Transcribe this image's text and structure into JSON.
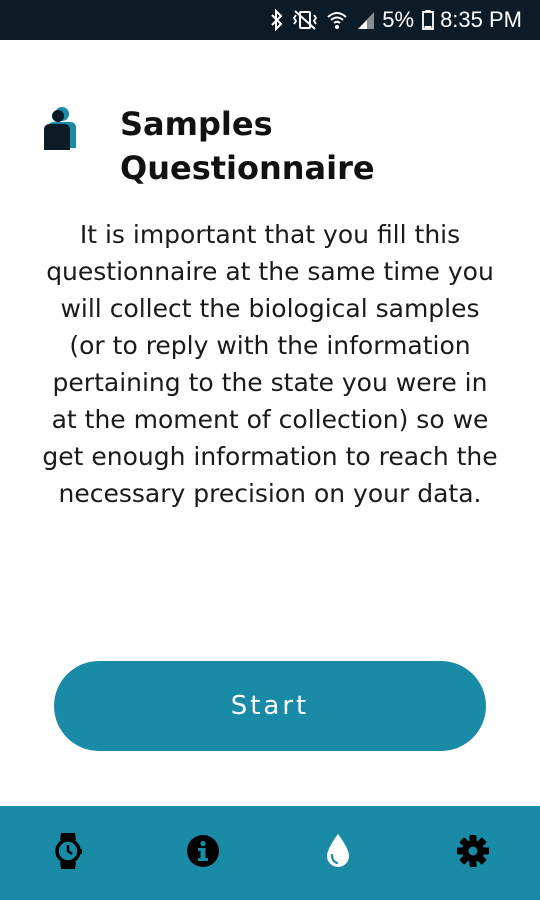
{
  "status_bar": {
    "battery_percent": "5%",
    "time": "8:35 PM",
    "icons": [
      "bluetooth-icon",
      "vibrate-icon",
      "wifi-icon",
      "signal-icon",
      "battery-icon"
    ]
  },
  "header": {
    "title": "Samples Questionnaire",
    "icon": "person-icon"
  },
  "main": {
    "description": "It is important that you fill this questionnaire at the same time you will collect the biological samples (or to reply with the information pertaining to the state you were in at the moment of collection) so we get enough information to reach the necessary precision on your data.",
    "start_label": "Start"
  },
  "bottom_nav": {
    "items": [
      {
        "icon": "watch-icon"
      },
      {
        "icon": "info-icon"
      },
      {
        "icon": "drop-icon",
        "active": true
      },
      {
        "icon": "gear-icon"
      }
    ]
  },
  "colors": {
    "accent": "#1a8ba6",
    "status_bar": "#0d1b26",
    "active_icon": "#ffffff",
    "inactive_icon": "#000000"
  }
}
